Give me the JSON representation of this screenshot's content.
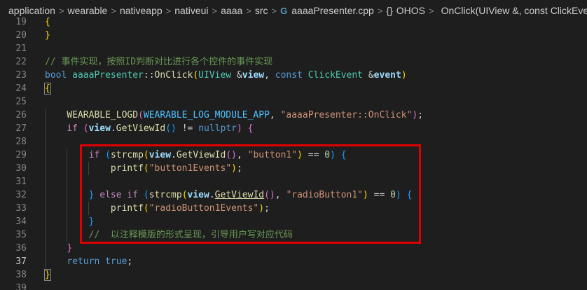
{
  "breadcrumb": {
    "items": [
      "application",
      "wearable",
      "nativeapp",
      "nativeui",
      "aaaa",
      "src"
    ],
    "separator": ">",
    "file_icon": "G",
    "file": "aaaaPresenter.cpp",
    "namespace": "OHOS",
    "namespace_icon": "{}",
    "symbol": "OnClick(UIView &, const ClickEvent &)"
  },
  "editor": {
    "active_line": 37,
    "lines": [
      {
        "n": 19,
        "t": "{"
      },
      {
        "n": 20,
        "t": "}"
      },
      {
        "n": 21,
        "t": ""
      },
      {
        "n": 22,
        "t": "// 事件实现，按照ID判断对比进行各个控件的事件实现"
      },
      {
        "n": 23,
        "t": "bool aaaaPresenter::OnClick(UIView &view, const ClickEvent &event)"
      },
      {
        "n": 24,
        "t": "{"
      },
      {
        "n": 25,
        "t": ""
      },
      {
        "n": 26,
        "t": "    WEARABLE_LOGD(WEARABLE_LOG_MODULE_APP, \"aaaaPresenter::OnClick\");"
      },
      {
        "n": 27,
        "t": "    if (view.GetViewId() != nullptr) {"
      },
      {
        "n": 28,
        "t": ""
      },
      {
        "n": 29,
        "t": "        if (strcmp(view.GetViewId(), \"button1\") == 0) {"
      },
      {
        "n": 30,
        "t": "            printf(\"button1Events\");"
      },
      {
        "n": 31,
        "t": ""
      },
      {
        "n": 32,
        "t": "        } else if (strcmp(view.GetViewId(), \"radioButton1\") == 0) {"
      },
      {
        "n": 33,
        "t": "            printf(\"radioButton1Events\");"
      },
      {
        "n": 34,
        "t": "        }"
      },
      {
        "n": 35,
        "t": "        //  以注释模版的形式呈现，引导用户写对应代码"
      },
      {
        "n": 36,
        "t": "    }"
      },
      {
        "n": 37,
        "t": "    return true;"
      },
      {
        "n": 38,
        "t": "}"
      },
      {
        "n": 39,
        "t": ""
      }
    ]
  }
}
